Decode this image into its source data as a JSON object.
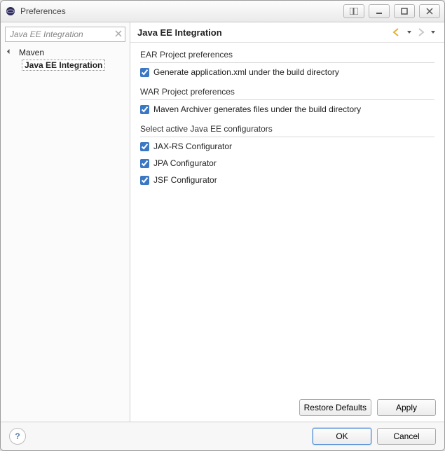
{
  "window": {
    "title": "Preferences"
  },
  "sidebar": {
    "filter_placeholder": "Java EE Integration",
    "items": [
      {
        "label": "Maven",
        "expanded": true,
        "selected": false
      },
      {
        "label": "Java EE Integration",
        "expanded": false,
        "selected": true
      }
    ]
  },
  "page": {
    "title": "Java EE Integration",
    "groups": [
      {
        "title": "EAR Project preferences",
        "options": [
          {
            "label": "Generate application.xml under the build directory",
            "checked": true
          }
        ]
      },
      {
        "title": "WAR Project preferences",
        "options": [
          {
            "label": "Maven Archiver generates files under the build directory",
            "checked": true
          }
        ]
      },
      {
        "title": "Select active Java EE configurators",
        "options": [
          {
            "label": "JAX-RS Configurator",
            "checked": true
          },
          {
            "label": "JPA Configurator",
            "checked": true
          },
          {
            "label": "JSF Configurator",
            "checked": true
          }
        ]
      }
    ],
    "buttons": {
      "restore_defaults": "Restore Defaults",
      "apply": "Apply"
    }
  },
  "footer": {
    "ok": "OK",
    "cancel": "Cancel",
    "help_tooltip": "Help"
  }
}
